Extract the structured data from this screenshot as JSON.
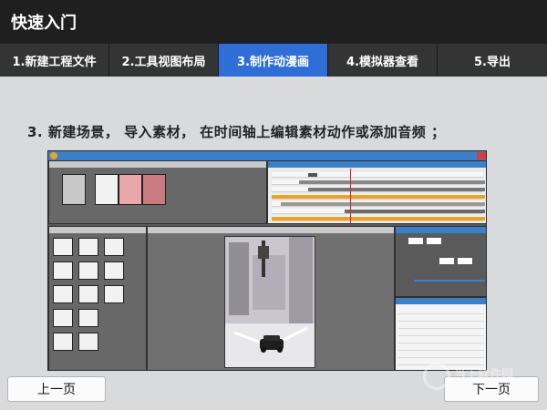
{
  "window": {
    "title": "快速入门"
  },
  "tabs": [
    {
      "label": "1.新建工程文件",
      "active": false
    },
    {
      "label": "2.工具视图布局",
      "active": false
    },
    {
      "label": "3.制作动漫画",
      "active": true
    },
    {
      "label": "4.模拟器查看",
      "active": false
    },
    {
      "label": "5.导出",
      "active": false
    }
  ],
  "instruction": "3. 新建场景， 导入素材， 在时间轴上编辑素材动作或添加音频 ；",
  "nav": {
    "prev_label": "上一页",
    "next_label": "下一页"
  },
  "colors": {
    "titlebar_bg": "#1f1f1f",
    "tab_bg": "#343434",
    "tab_active_bg": "#2f6ed6",
    "content_bg": "#d9dadb",
    "screenshot_accent": "#3c7fc8",
    "timeline_playhead": "#e02020"
  },
  "watermark": {
    "brand": "当下软件园",
    "url": "www.downxia.com"
  }
}
